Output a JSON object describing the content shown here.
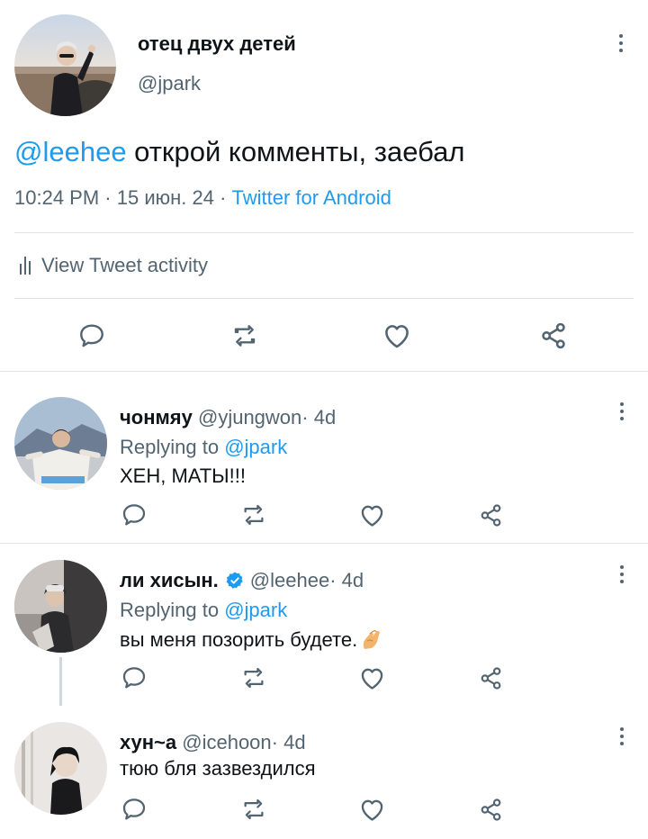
{
  "colors": {
    "accent": "#1d9bf0",
    "text": "#0f1419",
    "secondary": "#536471",
    "verified": "#1d9bf0"
  },
  "main_tweet": {
    "author_name": "отец двух детей",
    "author_handle": "@jpark",
    "mention": "@leehee",
    "text": " открой комменты, заебал",
    "time": "10:24 PM",
    "date": "15 июн. 24",
    "separator": " · ",
    "source": "Twitter for Android",
    "activity_label": "View Tweet activity",
    "activity_icon": "bar-chart-icon",
    "actions": [
      "reply-icon",
      "retweet-icon",
      "like-icon",
      "share-icon"
    ]
  },
  "replies": [
    {
      "name": "чонмяу",
      "handle": "@yjungwon",
      "age": " · 4d",
      "verified": false,
      "replying_prefix": "Replying to ",
      "replying_to": "@jpark",
      "text": "ХЕН, МАТЫ!!!"
    },
    {
      "name": "ли хисын.",
      "handle": "@leehee",
      "age": " · 4d",
      "verified": true,
      "replying_prefix": "Replying to ",
      "replying_to": "@jpark",
      "text": "вы меня позорить будете.",
      "emoji": "pinched-fingers-emoji"
    },
    {
      "name": "хун~а",
      "handle": "@icehoon",
      "age": " · 4d",
      "verified": false,
      "text": "тюю бля зазвездился"
    }
  ]
}
